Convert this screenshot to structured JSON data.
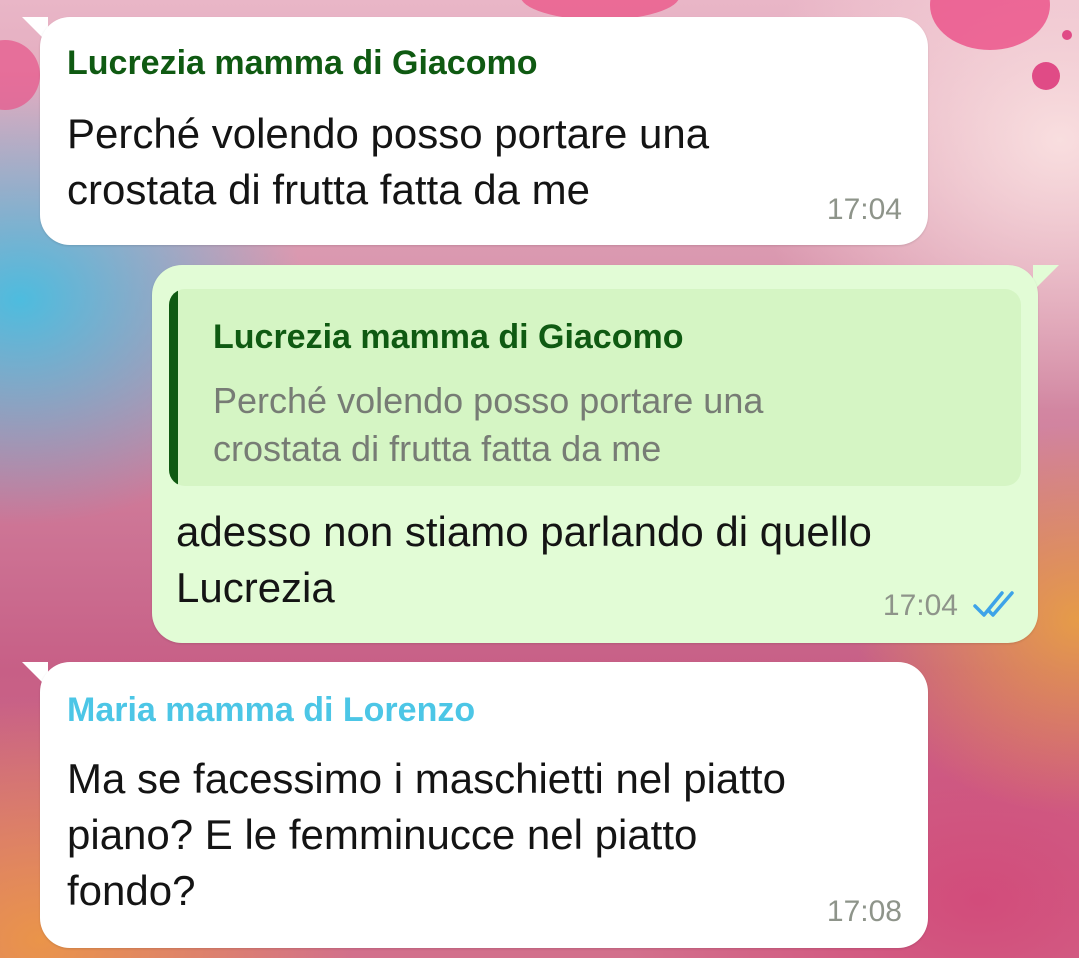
{
  "colors": {
    "sender_green": "#0f5a12",
    "sender_cyan": "#4cc6e6",
    "incoming_bubble": "#ffffff",
    "outgoing_bubble": "#e2fcd6",
    "quote_background": "#d5f5c4",
    "read_ticks": "#3ea3e8",
    "timestamp": "#8e948a"
  },
  "messages": [
    {
      "sender": "Lucrezia mamma di Giacomo",
      "lines": [
        "Perché volendo posso portare una",
        "crostata di frutta fatta da me"
      ],
      "time": "17:04"
    },
    {
      "quote": {
        "sender": "Lucrezia mamma di Giacomo",
        "lines": [
          "Perché volendo posso portare una",
          "crostata di frutta fatta da me"
        ]
      },
      "lines": [
        "adesso non stiamo parlando di quello",
        "Lucrezia"
      ],
      "time": "17:04",
      "status_icon": "double-check-read-icon"
    },
    {
      "sender": "Maria mamma di Lorenzo",
      "lines": [
        "Ma se facessimo i maschietti nel piatto",
        "piano? E le femminucce nel piatto",
        "fondo?"
      ],
      "time": "17:08"
    }
  ]
}
